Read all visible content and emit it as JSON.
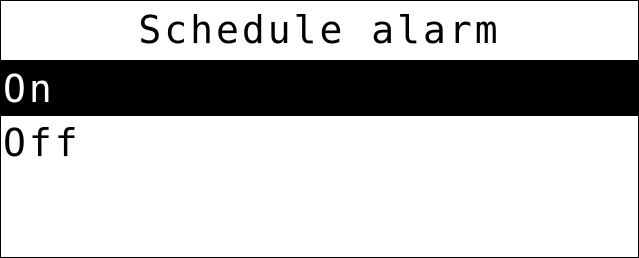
{
  "screen": {
    "title": "Schedule alarm",
    "colors": {
      "background": "#ffffff",
      "foreground": "#000000",
      "selection_background": "#000000",
      "selection_foreground": "#ffffff"
    },
    "menu": {
      "items": [
        {
          "label": "On",
          "selected": true
        },
        {
          "label": "Off",
          "selected": false
        }
      ]
    }
  }
}
